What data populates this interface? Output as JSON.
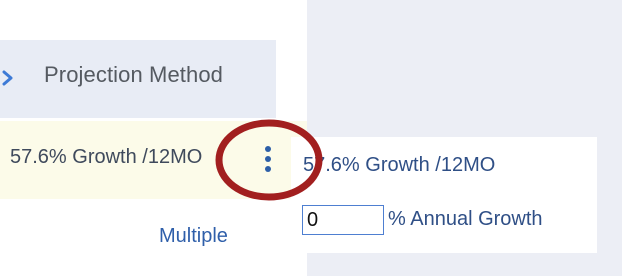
{
  "header": {
    "label": "Projection Method",
    "chevron_icon": "chevron-right-icon"
  },
  "row": {
    "value": "57.6% Growth /12MO",
    "menu_icon": "kebab-menu-icon"
  },
  "popup": {
    "title": "57.6% Growth /12MO",
    "input_value": "0",
    "input_suffix": "% Annual Growth"
  },
  "multiple_link": "Multiple",
  "colors": {
    "accent": "#3d7ad6",
    "annotation": "#a21f1f",
    "row_highlight": "#fcfbe9",
    "panel_gray": "#eceef5"
  }
}
